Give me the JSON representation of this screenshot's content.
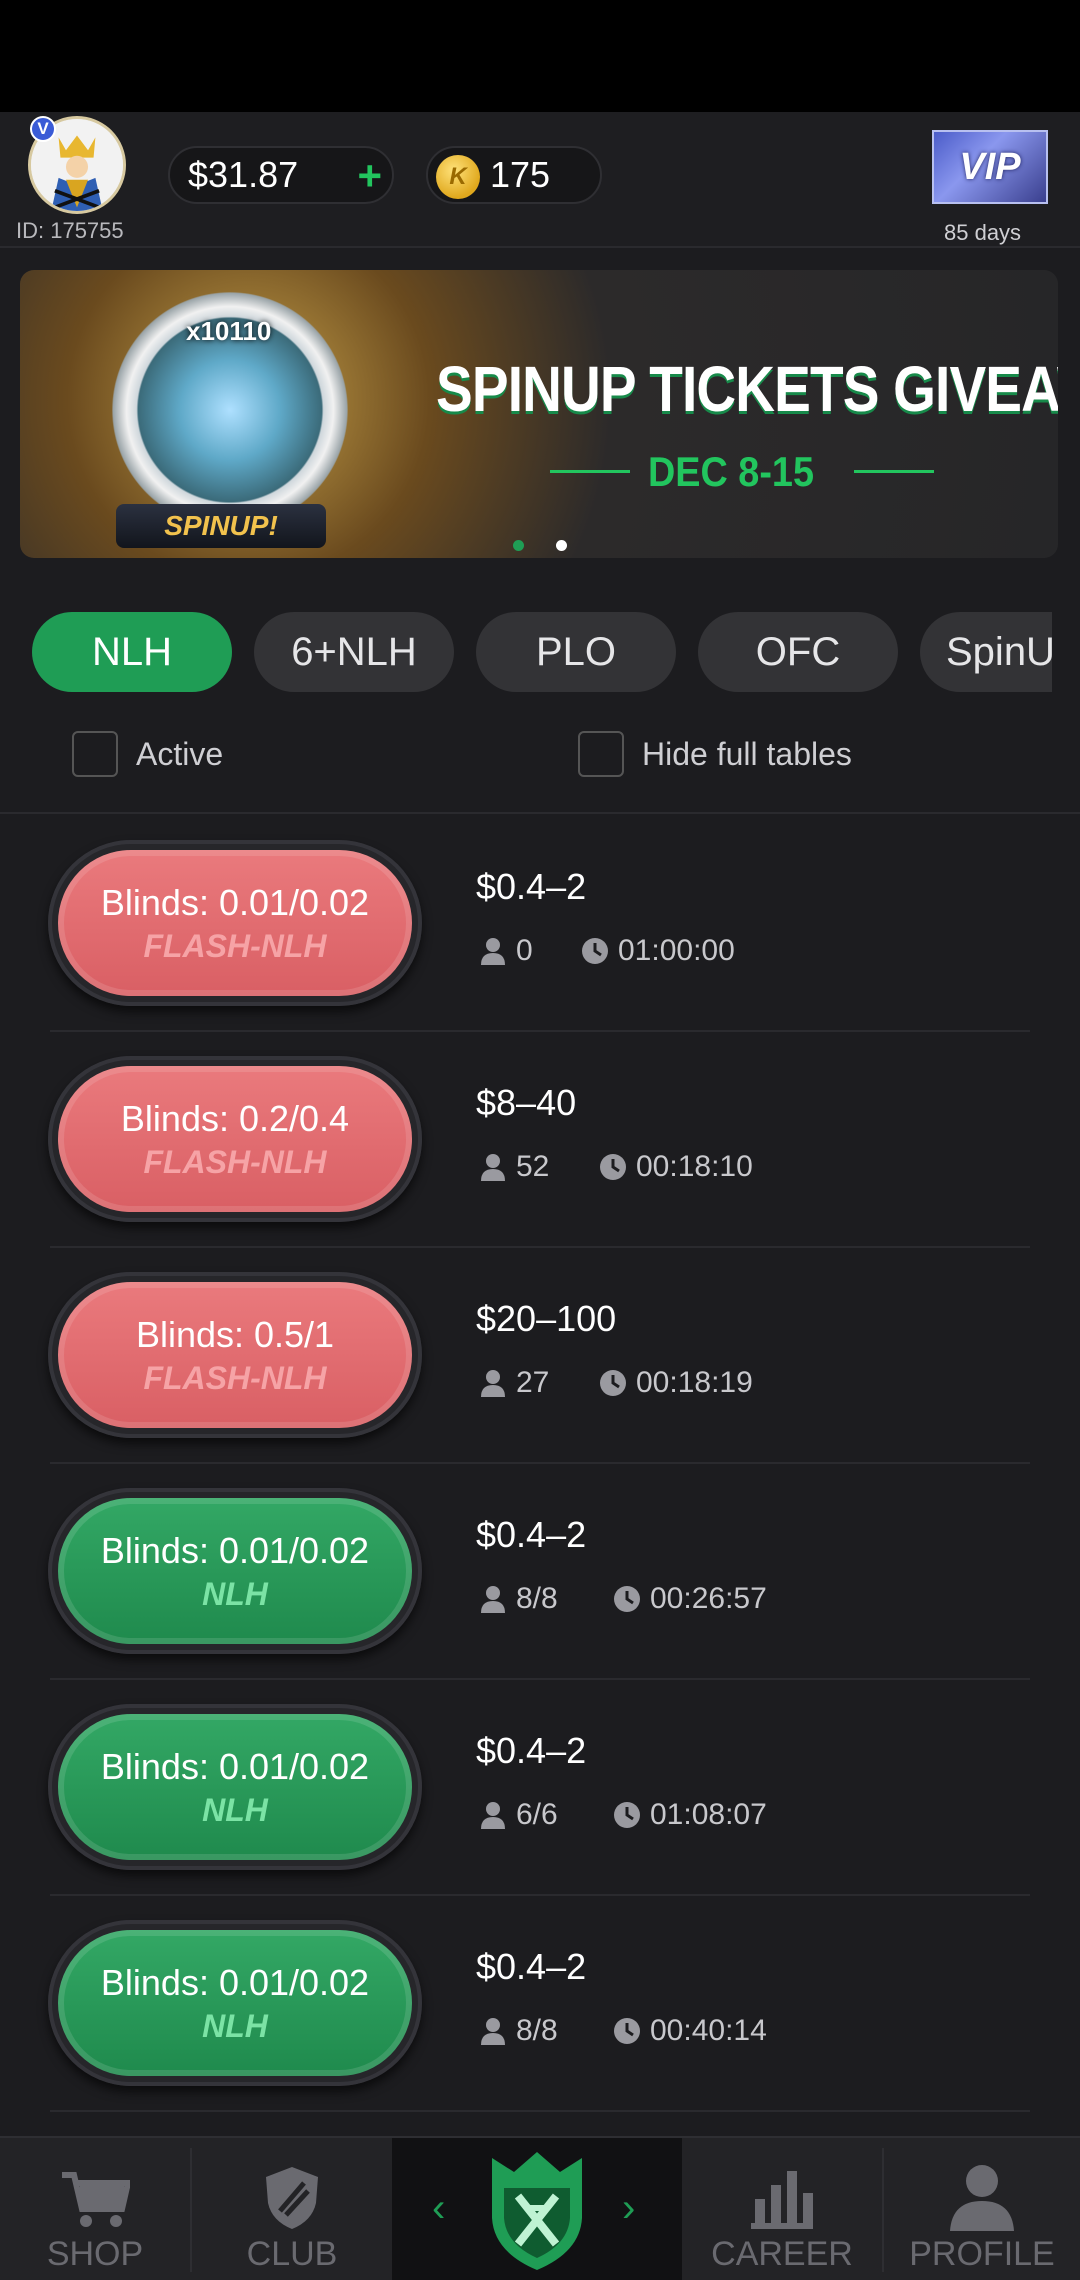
{
  "header": {
    "user_id": "ID: 175755",
    "avatar_badge": "V",
    "balance": "$31.87",
    "add_funds": "+",
    "coin_symbol": "K",
    "coins": "175",
    "vip_label": "VIP",
    "vip_days": "85 days"
  },
  "banner": {
    "multiplier": "x10110",
    "logo": "SPINUP!",
    "title": "SPINUP TICKETS GIVEAWAY",
    "date": "DEC 8-15",
    "active_slide": 1,
    "slide_count": 2
  },
  "tabs": [
    {
      "label": "NLH",
      "active": true
    },
    {
      "label": "6+NLH",
      "active": false
    },
    {
      "label": "PLO",
      "active": false
    },
    {
      "label": "OFC",
      "active": false
    },
    {
      "label": "SpinU",
      "active": false
    }
  ],
  "filters": {
    "active_label": "Active",
    "hide_full_label": "Hide full tables",
    "active_checked": false,
    "hide_full_checked": false
  },
  "tables": [
    {
      "blinds": "Blinds: 0.01/0.02",
      "type": "FLASH-NLH",
      "color": "red",
      "buyin": "$0.4–2",
      "players": "0",
      "time": "01:00:00"
    },
    {
      "blinds": "Blinds: 0.2/0.4",
      "type": "FLASH-NLH",
      "color": "red",
      "buyin": "$8–40",
      "players": "52",
      "time": "00:18:10"
    },
    {
      "blinds": "Blinds: 0.5/1",
      "type": "FLASH-NLH",
      "color": "red",
      "buyin": "$20–100",
      "players": "27",
      "time": "00:18:19"
    },
    {
      "blinds": "Blinds: 0.01/0.02",
      "type": "NLH",
      "color": "green",
      "buyin": "$0.4–2",
      "players": "8/8",
      "time": "00:26:57"
    },
    {
      "blinds": "Blinds: 0.01/0.02",
      "type": "NLH",
      "color": "green",
      "buyin": "$0.4–2",
      "players": "6/6",
      "time": "01:08:07"
    },
    {
      "blinds": "Blinds: 0.01/0.02",
      "type": "NLH",
      "color": "green",
      "buyin": "$0.4–2",
      "players": "8/8",
      "time": "00:40:14"
    }
  ],
  "bottom_nav": {
    "shop": "SHOP",
    "club": "CLUB",
    "prev": "‹",
    "next": "›",
    "career": "CAREER",
    "profile": "PROFILE"
  },
  "colors": {
    "accent_green": "#1f9d55",
    "flash_red": "#e06b6f",
    "background": "#1c1c1f"
  }
}
